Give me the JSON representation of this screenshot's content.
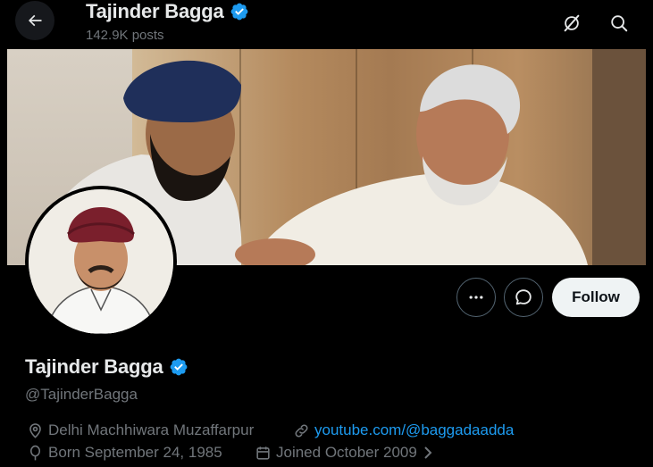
{
  "header": {
    "name": "Tajinder Bagga",
    "posts": "142.9K posts"
  },
  "profile": {
    "name": "Tajinder Bagga",
    "handle": "@TajinderBagga",
    "follow_label": "Follow",
    "location": "Delhi Machhiwara Muzaffarpur",
    "website": "youtube.com/@baggadaadda",
    "born": "Born September 24, 1985",
    "joined": "Joined October 2009"
  },
  "colors": {
    "background": "#000000",
    "verified": "#1d9bf0",
    "link": "#1d9bf0",
    "secondary_text": "#71767b",
    "follow_bg": "#eff3f4"
  },
  "icons": [
    "back-arrow-icon",
    "verified-badge-icon",
    "grok-icon",
    "search-icon",
    "more-icon",
    "message-icon",
    "location-icon",
    "link-icon",
    "balloon-icon",
    "calendar-icon",
    "chevron-right-icon"
  ]
}
